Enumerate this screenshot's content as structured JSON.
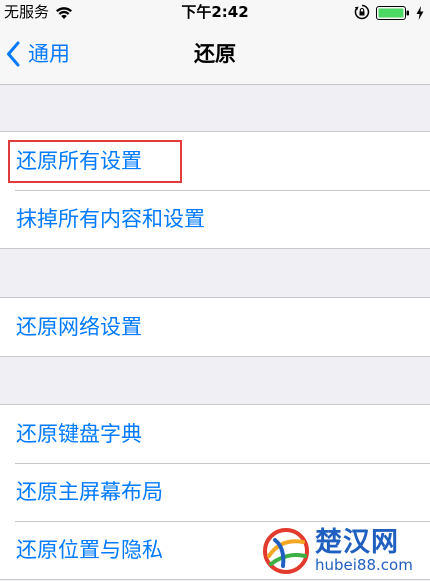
{
  "status_bar": {
    "carrier": "无服务",
    "time": "下午2:42"
  },
  "nav": {
    "back_label": "通用",
    "title": "还原"
  },
  "groups": [
    {
      "items": [
        {
          "label": "还原所有设置",
          "highlighted": true
        },
        {
          "label": "抹掉所有内容和设置"
        }
      ]
    },
    {
      "items": [
        {
          "label": "还原网络设置"
        }
      ]
    },
    {
      "items": [
        {
          "label": "还原键盘字典"
        },
        {
          "label": "还原主屏幕布局"
        },
        {
          "label": "还原位置与隐私"
        }
      ]
    }
  ],
  "watermark": {
    "main": "楚汉网",
    "sub": "hubei88.com"
  },
  "colors": {
    "accent": "#007aff",
    "background": "#efeff4",
    "cell_background": "#ffffff",
    "separator": "#c8c7cc",
    "highlight_border": "#e03c3c",
    "watermark_blue": "#1f5fbf"
  },
  "icons": [
    "wifi-icon",
    "lock-rotation-icon",
    "battery-icon",
    "charging-icon",
    "chevron-left-icon",
    "watermark-logo-icon"
  ]
}
